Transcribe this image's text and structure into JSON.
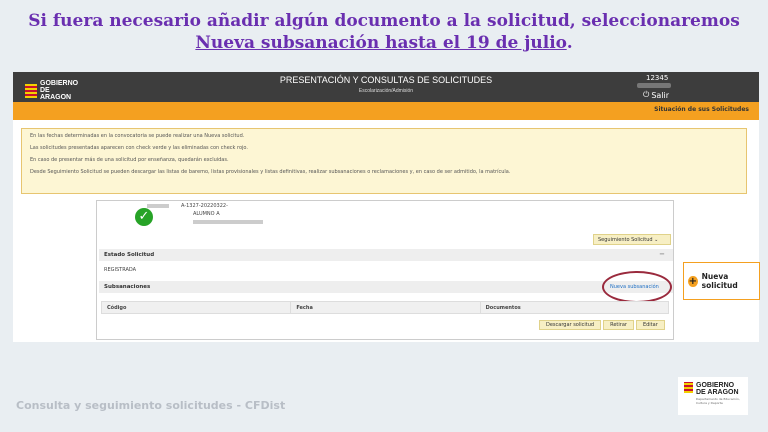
{
  "headline": {
    "line1": "Si fuera necesario añadir algún documento a la solicitud, seleccionaremos",
    "line2": "Nueva subsanación hasta el 19 de julio",
    "line2_suffix": "."
  },
  "app": {
    "logo": "GOBIERNO DE ARAGON",
    "title": "PRESENTACIÓN Y CONSULTAS DE SOLICITUDES",
    "subtitle": "Escolarización/Admisión",
    "user_number": "12345",
    "logout": "Salir",
    "orange_link": "Situación de sus Solicitudes"
  },
  "info": [
    "En las fechas determinadas en la convocatoria se puede realizar una Nueva solicitud.",
    "Las solicitudes presentadas aparecen con check verde y las eliminadas con check rojo.",
    "En caso de presentar más de una solicitud por enseñanza, quedarán excluidas.",
    "Desde Seguimiento Solicitud se pueden descargar las listas de baremo, listas provisionales y listas definitivas, realizar subsanaciones o reclamaciones y, en caso de ser admitido, la matrícula."
  ],
  "application": {
    "code": "A-1327-20220322-",
    "student": "ALUMNO A",
    "tracking_button": "Seguimiento Solicitud",
    "status_section": "Estado Solicitud",
    "status_value": "REGISTRADA",
    "subsanaciones_section": "Subsanaciones",
    "new_subsanacion": "Nueva subsanación",
    "table_headers": [
      "Código",
      "Fecha",
      "Documentos"
    ],
    "actions": [
      "Descargar solicitud",
      "Retirar",
      "Editar"
    ]
  },
  "side_button": "Nueva solicitud",
  "footer": "Consulta y seguimiento solicitudes - CFDist",
  "footer_logo": {
    "line1": "GOBIERNO",
    "line2": "DE ARAGON",
    "dept": "Departamento de Educación, Cultura y Deporte"
  },
  "colors": {
    "accent": "#f4a020",
    "headline": "#6a2fb0",
    "ok": "#27a327"
  }
}
